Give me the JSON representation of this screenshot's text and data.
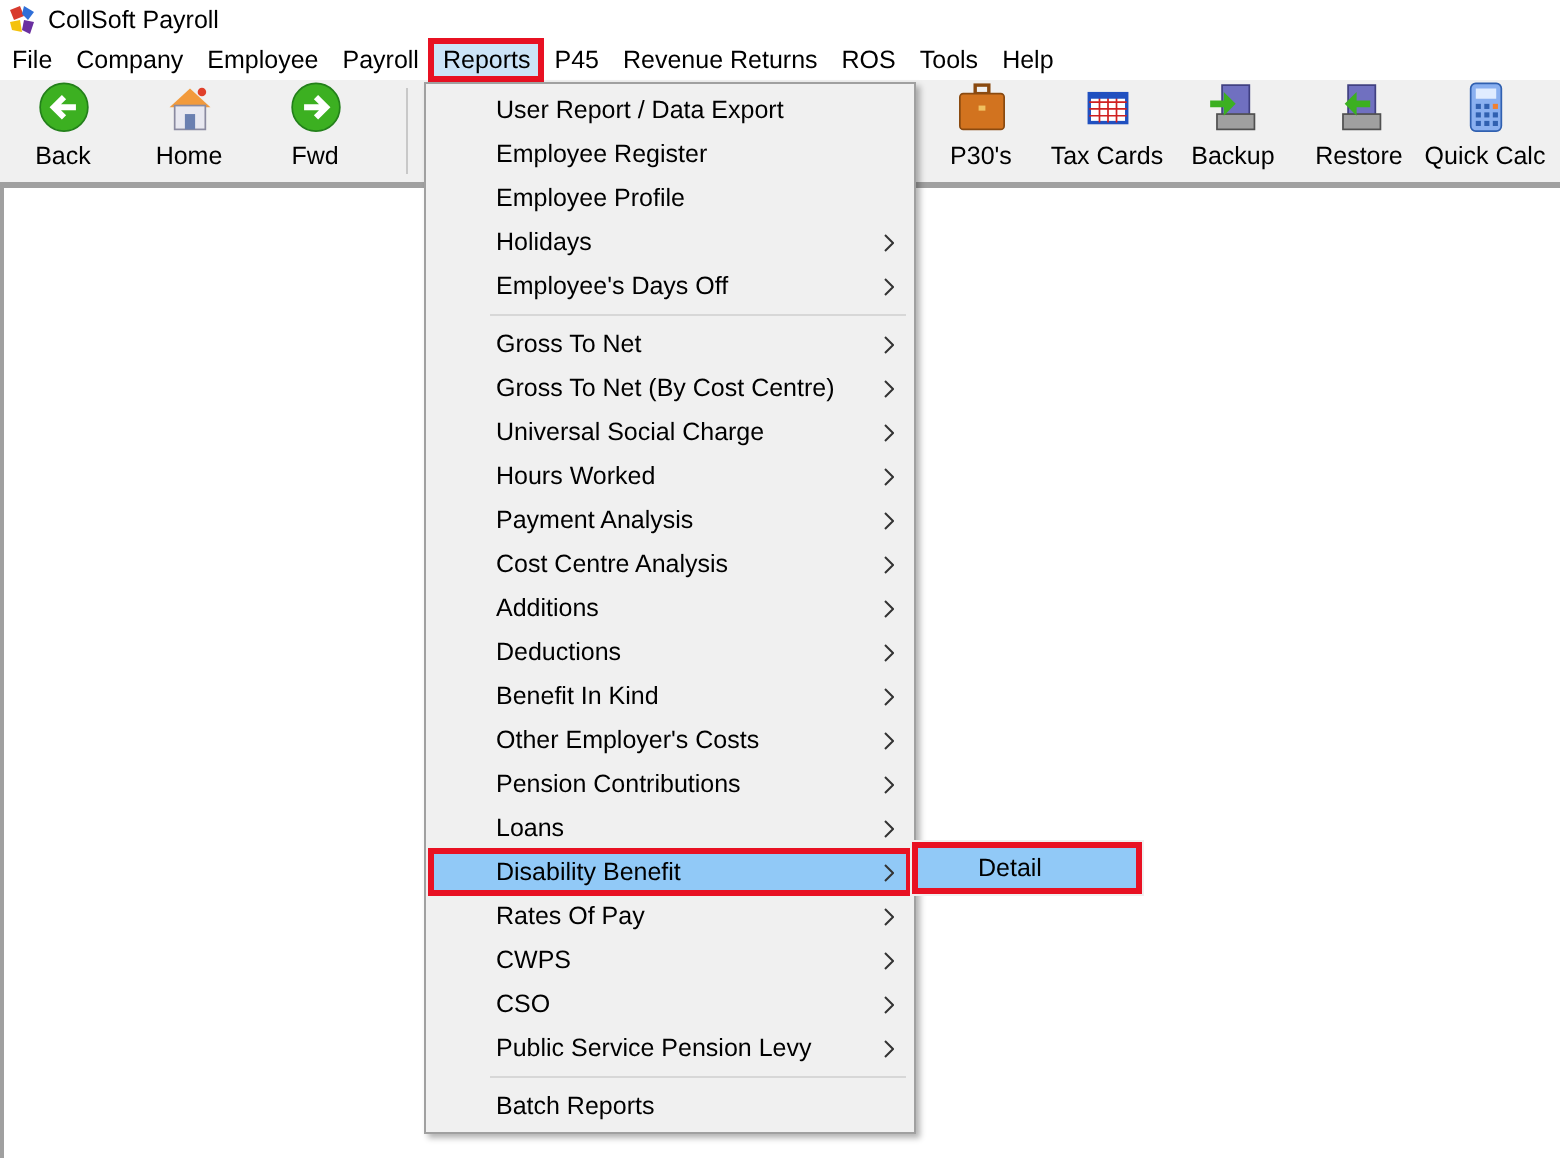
{
  "window": {
    "title": "CollSoft Payroll"
  },
  "menu_bar": [
    {
      "label": "File",
      "selected": false,
      "annotated": false
    },
    {
      "label": "Company",
      "selected": false,
      "annotated": false
    },
    {
      "label": "Employee",
      "selected": false,
      "annotated": false
    },
    {
      "label": "Payroll",
      "selected": false,
      "annotated": false
    },
    {
      "label": "Reports",
      "selected": true,
      "annotated": true
    },
    {
      "label": "P45",
      "selected": false,
      "annotated": false
    },
    {
      "label": "Revenue Returns",
      "selected": false,
      "annotated": false
    },
    {
      "label": "ROS",
      "selected": false,
      "annotated": false
    },
    {
      "label": "Tools",
      "selected": false,
      "annotated": false
    },
    {
      "label": "Help",
      "selected": false,
      "annotated": false
    }
  ],
  "toolbar": {
    "left": [
      {
        "label": "Back"
      },
      {
        "label": "Home"
      },
      {
        "label": "Fwd"
      }
    ],
    "right": [
      {
        "label": "P30's"
      },
      {
        "label": "Tax Cards"
      },
      {
        "label": "Backup"
      },
      {
        "label": "Restore"
      },
      {
        "label": "Quick Calc"
      }
    ]
  },
  "reports_menu": [
    {
      "kind": "item",
      "label": "User Report / Data Export",
      "submenu": false,
      "selected": false,
      "annotated": false
    },
    {
      "kind": "item",
      "label": "Employee Register",
      "submenu": false,
      "selected": false,
      "annotated": false
    },
    {
      "kind": "item",
      "label": "Employee Profile",
      "submenu": false,
      "selected": false,
      "annotated": false
    },
    {
      "kind": "item",
      "label": "Holidays",
      "submenu": true,
      "selected": false,
      "annotated": false
    },
    {
      "kind": "item",
      "label": "Employee's Days Off",
      "submenu": true,
      "selected": false,
      "annotated": false
    },
    {
      "kind": "separator"
    },
    {
      "kind": "item",
      "label": "Gross To Net",
      "submenu": true,
      "selected": false,
      "annotated": false
    },
    {
      "kind": "item",
      "label": "Gross To Net (By Cost Centre)",
      "submenu": true,
      "selected": false,
      "annotated": false
    },
    {
      "kind": "item",
      "label": "Universal Social Charge",
      "submenu": true,
      "selected": false,
      "annotated": false
    },
    {
      "kind": "item",
      "label": "Hours Worked",
      "submenu": true,
      "selected": false,
      "annotated": false
    },
    {
      "kind": "item",
      "label": "Payment Analysis",
      "submenu": true,
      "selected": false,
      "annotated": false
    },
    {
      "kind": "item",
      "label": "Cost Centre Analysis",
      "submenu": true,
      "selected": false,
      "annotated": false
    },
    {
      "kind": "item",
      "label": "Additions",
      "submenu": true,
      "selected": false,
      "annotated": false
    },
    {
      "kind": "item",
      "label": "Deductions",
      "submenu": true,
      "selected": false,
      "annotated": false
    },
    {
      "kind": "item",
      "label": "Benefit In Kind",
      "submenu": true,
      "selected": false,
      "annotated": false
    },
    {
      "kind": "item",
      "label": "Other Employer's Costs",
      "submenu": true,
      "selected": false,
      "annotated": false
    },
    {
      "kind": "item",
      "label": "Pension Contributions",
      "submenu": true,
      "selected": false,
      "annotated": false
    },
    {
      "kind": "item",
      "label": "Loans",
      "submenu": true,
      "selected": false,
      "annotated": false
    },
    {
      "kind": "item",
      "label": "Disability Benefit",
      "submenu": true,
      "selected": true,
      "annotated": true
    },
    {
      "kind": "item",
      "label": "Rates Of Pay",
      "submenu": true,
      "selected": false,
      "annotated": false
    },
    {
      "kind": "item",
      "label": "CWPS",
      "submenu": true,
      "selected": false,
      "annotated": false
    },
    {
      "kind": "item",
      "label": "CSO",
      "submenu": true,
      "selected": false,
      "annotated": false
    },
    {
      "kind": "item",
      "label": "Public Service Pension Levy",
      "submenu": true,
      "selected": false,
      "annotated": false
    },
    {
      "kind": "separator"
    },
    {
      "kind": "item",
      "label": "Batch Reports",
      "submenu": false,
      "selected": false,
      "annotated": false
    }
  ],
  "submenu": [
    {
      "label": "Detail",
      "selected": true,
      "annotated": true
    }
  ]
}
